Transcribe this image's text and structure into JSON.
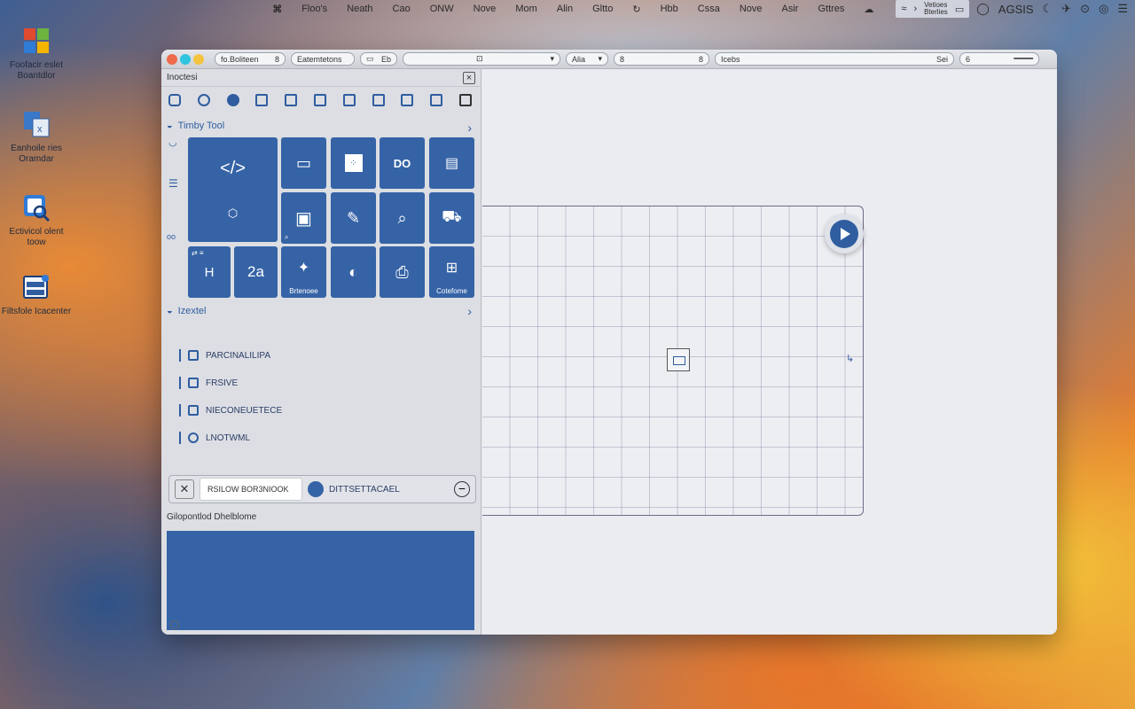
{
  "menubar": {
    "items": [
      "Floo's",
      "Neath",
      "Cao",
      "ONW",
      "Nove",
      "Mom",
      "Alin",
      "Gltto",
      "Hbb",
      "Cssa",
      "Nove",
      "Asir",
      "Gttres"
    ],
    "status_small_top": "Vetioes",
    "status_small_bottom": "Bterlies",
    "clock": "AGSIS"
  },
  "desktop_icons": [
    {
      "label": "Foofacir eslet Boantdlor",
      "icon": "windows-logo-icon"
    },
    {
      "label": "Eanhoile ries Oramdar",
      "icon": "excel-icon"
    },
    {
      "label": "Ectivicol olent toow",
      "icon": "magnifier-window-icon"
    },
    {
      "label": "Filtsfole Icacenter",
      "icon": "server-box-icon"
    }
  ],
  "titlebar": {
    "fields": [
      {
        "left": "fo.Boliteen",
        "right": "8"
      },
      {
        "left": "Eatemtetons",
        "right": ""
      },
      {
        "left": "",
        "right": "Eb"
      },
      {
        "left": "",
        "right": ""
      },
      {
        "left": "",
        "right": "Alia"
      },
      {
        "left": "8",
        "right": "8"
      },
      {
        "left": "Icebs",
        "right": "Sei"
      },
      {
        "left": "6",
        "right": ""
      }
    ],
    "traffic_colors": [
      "#ee6a4a",
      "#2fc4e0",
      "#f4c440"
    ]
  },
  "panel": {
    "header": "Inoctesi",
    "section1_title": "Timby Tool",
    "section2_title": "Izextel",
    "tiles": [
      {
        "glyph": "</>",
        "label": ""
      },
      {
        "glyph": "",
        "label": ""
      },
      {
        "glyph": "",
        "label": ""
      },
      {
        "glyph": "DO",
        "label": ""
      },
      {
        "glyph": "",
        "label": ""
      },
      {
        "glyph": "",
        "label": ""
      },
      {
        "glyph": "",
        "label": ""
      },
      {
        "glyph": "",
        "label": ""
      },
      {
        "glyph": "",
        "label": ""
      },
      {
        "glyph": "H",
        "label": ""
      },
      {
        "glyph": "2a",
        "label": ""
      },
      {
        "glyph": "",
        "label": "Brtenoee"
      },
      {
        "glyph": "",
        "label": ""
      },
      {
        "glyph": "",
        "label": ""
      },
      {
        "glyph": "",
        "label": "Cotefome"
      }
    ],
    "list": [
      "PARCINALILIPA",
      "FRSIVE",
      "NIECONEUETECE",
      "LNOTWML"
    ],
    "search_value": "RSILOW BOR3NIOOK",
    "action_label": "DITTSETTACAEL",
    "gen_label": "Gilopontlod Dhelblome"
  },
  "colors": {
    "accent": "#3563a6",
    "accent_dark": "#2f5da0"
  }
}
